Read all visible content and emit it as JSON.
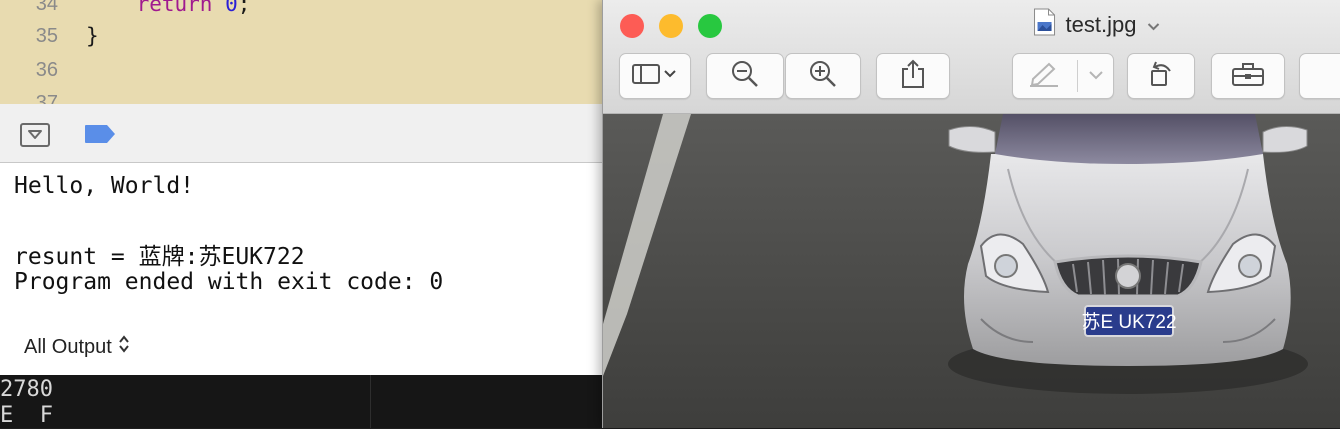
{
  "editor": {
    "lines": [
      {
        "number": "34",
        "code": "    return 0;"
      },
      {
        "number": "35",
        "code": "}"
      },
      {
        "number": "36",
        "code": ""
      },
      {
        "number": "37",
        "code": ""
      }
    ]
  },
  "console": {
    "lines": [
      "Hello, World!",
      "",
      "resunt = 蓝牌:苏EUK722",
      "Program ended with exit code: 0"
    ],
    "filter_label": "All Output",
    "filter_icon": "up-down-chevron-icon"
  },
  "bottom_strip": {
    "fragment_line1": "2780",
    "fragment_line2": "E  F"
  },
  "preview": {
    "title": "test.jpg",
    "file_icon": "jpeg-document-icon",
    "traffic_lights": {
      "close": "#fd5c55",
      "minimize": "#fdbb2d",
      "zoom": "#28c840"
    },
    "toolbar_icons": [
      "sidebar-icon",
      "zoom-out-icon",
      "zoom-in-icon",
      "share-icon",
      "markup-pen-icon",
      "rotate-left-icon",
      "toolbox-icon"
    ],
    "image": {
      "plate_text": "苏E UK722",
      "plate_color": "#2a3c8c"
    }
  }
}
